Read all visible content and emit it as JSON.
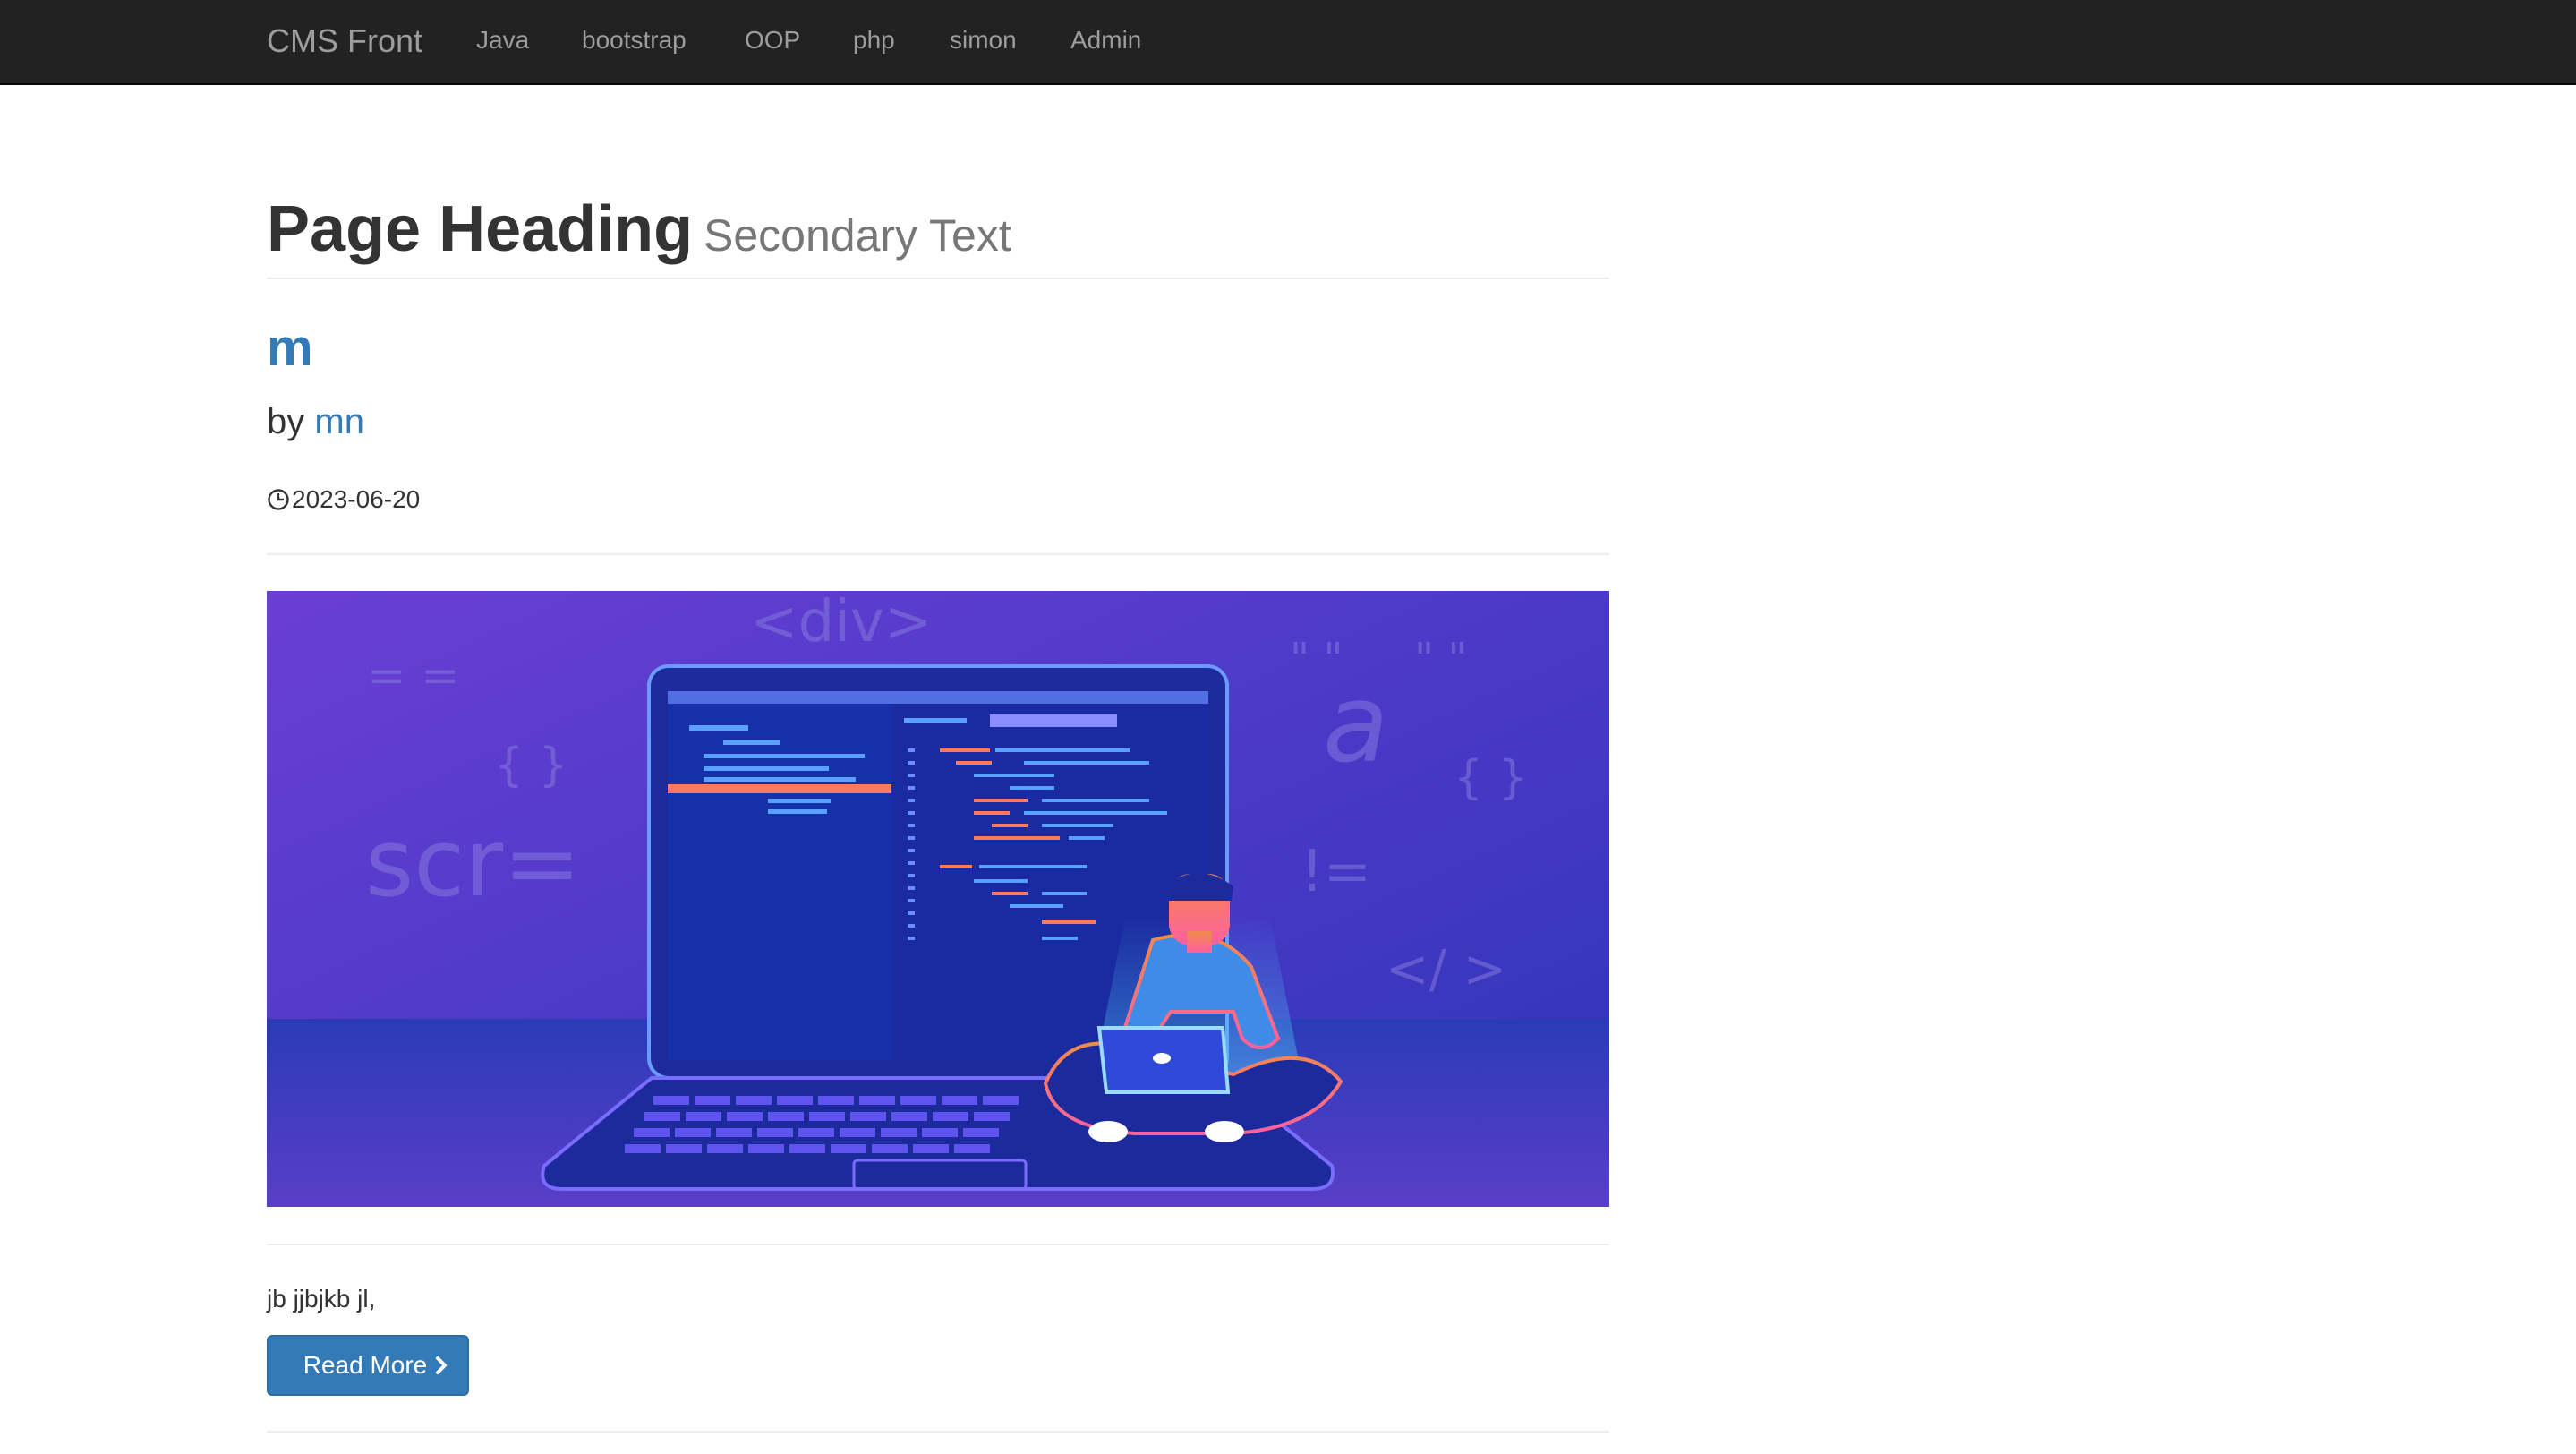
{
  "navbar": {
    "brand": "CMS Front",
    "links": [
      "Java",
      "bootstrap",
      "OOP",
      "php",
      "simon",
      "Admin"
    ],
    "background": "#222222",
    "link_color": "#9d9d9d"
  },
  "header": {
    "title": "Page Heading",
    "subtitle": "Secondary Text"
  },
  "post": {
    "title": "m",
    "by_label": "by",
    "author": "mn",
    "date_icon": "clock-icon",
    "date": "2023-06-20",
    "image": {
      "kind": "illustration",
      "decor_text": [
        "<div>",
        "scr=",
        "= =",
        "{ }",
        "{ }",
        "!=",
        "</ >",
        "a",
        "\" \"",
        "\" \""
      ]
    },
    "excerpt": "jb jjbjkb jl,",
    "read_more_label": "Read More",
    "read_more_icon": "chevron-right-icon"
  },
  "colors": {
    "link": "#337ab7",
    "button": "#337ab7",
    "image_bg_top": "#5b3fd0",
    "image_bg_bottom": "#3a2bb0"
  }
}
